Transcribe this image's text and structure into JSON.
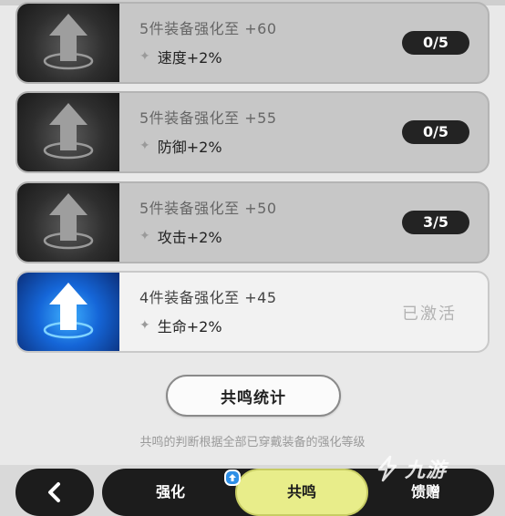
{
  "tiers": [
    {
      "title": "5件装备强化至 +60",
      "bonus": "速度+2%",
      "status": "0/5",
      "active": false
    },
    {
      "title": "5件装备强化至 +55",
      "bonus": "防御+2%",
      "status": "0/5",
      "active": false
    },
    {
      "title": "5件装备强化至 +50",
      "bonus": "攻击+2%",
      "status": "3/5",
      "active": false
    },
    {
      "title": "4件装备强化至 +45",
      "bonus": "生命+2%",
      "status": "已激活",
      "active": true
    }
  ],
  "stats_button": {
    "label": "共鸣统计"
  },
  "footnote": "共鸣的判断根据全部已穿戴装备的强化等级",
  "tabs": [
    {
      "label": "强化"
    },
    {
      "label": "共鸣",
      "selected": true
    },
    {
      "label": "馈赠"
    }
  ],
  "watermark": {
    "text": "九游"
  },
  "colors": {
    "active_tab": "#e8ed8a",
    "active_icon": "#1566d8",
    "badge": "#232323"
  }
}
